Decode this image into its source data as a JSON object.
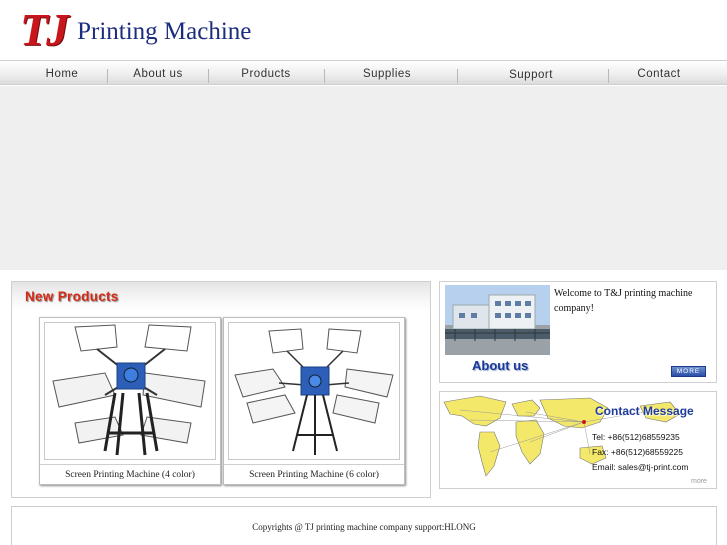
{
  "header": {
    "logo_mark": "TJ",
    "logo_text": "Printing Machine"
  },
  "nav": {
    "items": [
      {
        "label": "Home"
      },
      {
        "label": "About us"
      },
      {
        "label": "Products"
      },
      {
        "label": "Supplies"
      },
      {
        "label": "Support"
      },
      {
        "label": "Contact"
      }
    ]
  },
  "new_products": {
    "title": "New Products",
    "items": [
      {
        "caption": "Screen Printing Machine (4 color)"
      },
      {
        "caption": "Screen Printing Machine (6 color)"
      }
    ]
  },
  "about": {
    "text": "Welcome to T&J printing machine company!",
    "heading": "About us",
    "more_label": "MORE"
  },
  "contact": {
    "heading": "Contact Message",
    "tel": "Tel: +86(512)68559235",
    "fax": "Fax: +86(512)68559225",
    "email": "Email: sales@tj-print.com",
    "more_label": "more"
  },
  "footer": {
    "text": "Copyrights @ TJ printing machine company support:HLONG"
  },
  "colors": {
    "logo_red": "#c8171c",
    "logo_blue": "#1d2d7d",
    "new_products_red": "#d62a16",
    "heading_blue": "#1a3a9a",
    "banner_gray": "#efefef"
  }
}
